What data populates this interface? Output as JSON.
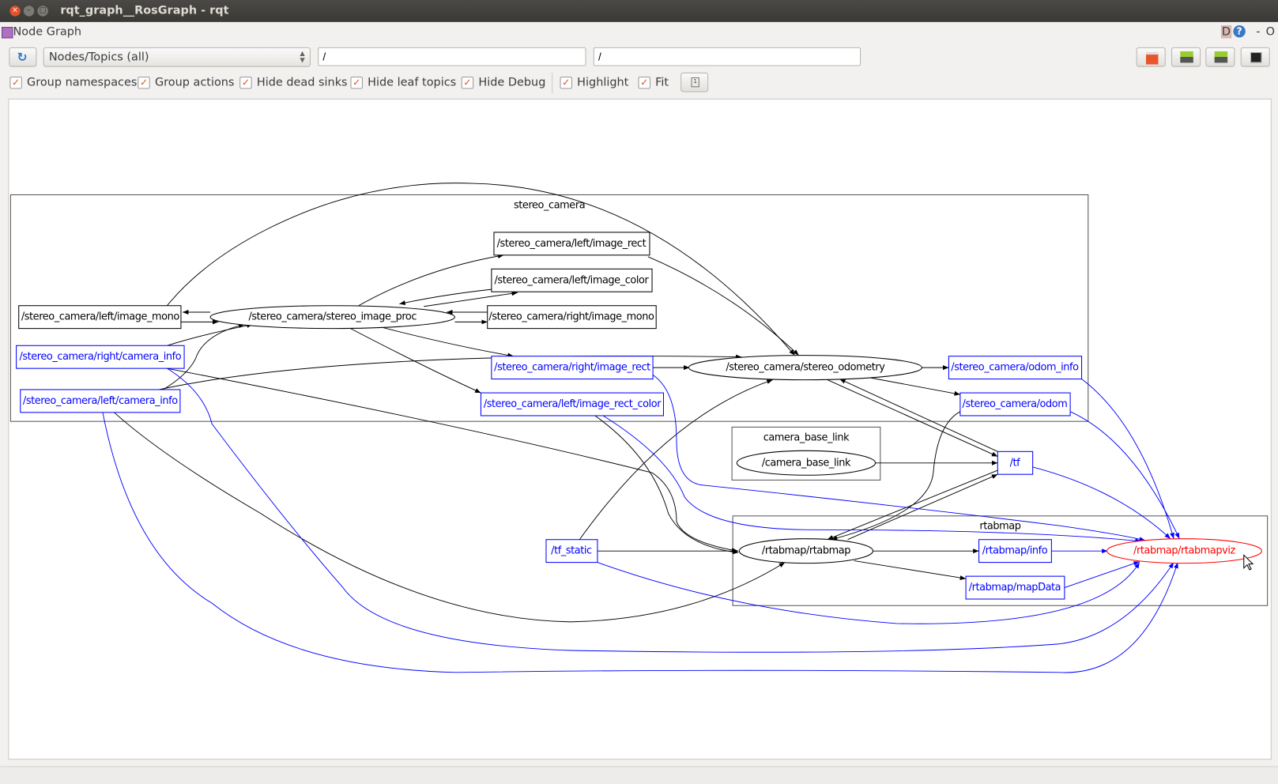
{
  "window": {
    "title": "rqt_graph__RosGraph - rqt"
  },
  "plugin": {
    "title": "Node Graph",
    "help_labels": [
      "D",
      "?",
      "-",
      "O"
    ]
  },
  "toolbar": {
    "refresh_icon": "refresh-icon",
    "mode": "Nodes/Topics (all)",
    "filter1": "/",
    "filter2": "/",
    "checkboxes": [
      {
        "label": "Group namespaces",
        "checked": true
      },
      {
        "label": "Group actions",
        "checked": true
      },
      {
        "label": "Hide dead sinks",
        "checked": true
      },
      {
        "label": "Hide leaf topics",
        "checked": true
      },
      {
        "label": "Hide Debug",
        "checked": true
      },
      {
        "label": "Highlight",
        "checked": true
      },
      {
        "label": "Fit",
        "checked": true
      }
    ],
    "right_buttons": [
      "open-icon",
      "save-dot-icon",
      "save-image-icon",
      "screenshot-icon"
    ]
  },
  "graph": {
    "colors": {
      "topic": "#0000ff",
      "node": "#000000",
      "highlight": "#ff0000"
    },
    "clusters": [
      "stereo_camera",
      "camera_base_link",
      "rtabmap"
    ],
    "nodes": {
      "left_image_mono": "/stereo_camera/left/image_mono",
      "stereo_image_proc": "/stereo_camera/stereo_image_proc",
      "left_image_rect": "/stereo_camera/left/image_rect",
      "left_image_color": "/stereo_camera/left/image_color",
      "right_image_mono": "/stereo_camera/right/image_mono",
      "right_camera_info": "/stereo_camera/right/camera_info",
      "left_camera_info": "/stereo_camera/left/camera_info",
      "right_image_rect": "/stereo_camera/right/image_rect",
      "left_image_rect_color": "/stereo_camera/left/image_rect_color",
      "stereo_odometry": "/stereo_camera/stereo_odometry",
      "odom_info": "/stereo_camera/odom_info",
      "odom": "/stereo_camera/odom",
      "camera_base_link": "/camera_base_link",
      "tf": "/tf",
      "tf_static": "/tf_static",
      "rtabmap": "/rtabmap/rtabmap",
      "rtabmap_info": "/rtabmap/info",
      "mapData": "/rtabmap/mapData",
      "rtabmapviz": "/rtabmap/rtabmapviz"
    }
  }
}
